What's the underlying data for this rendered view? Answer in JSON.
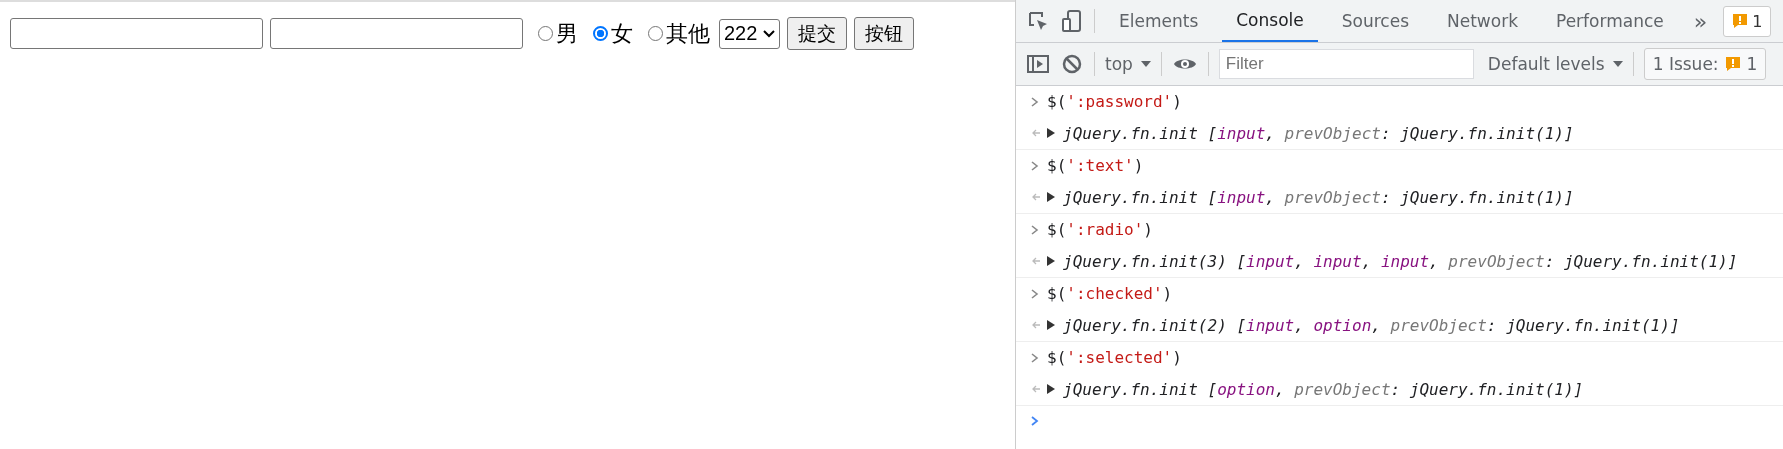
{
  "page": {
    "text_fields": [
      {
        "kind": "input"
      },
      {
        "kind": "input"
      }
    ],
    "radios": [
      {
        "label": "男",
        "selected": false
      },
      {
        "label": "女",
        "selected": true
      },
      {
        "label": "其他",
        "selected": false
      }
    ],
    "select": {
      "value": "222"
    },
    "buttons": [
      "提交",
      "按钮"
    ]
  },
  "devtools": {
    "tabs": [
      {
        "label": "Elements",
        "selected": false
      },
      {
        "label": "Console",
        "selected": true
      },
      {
        "label": "Sources",
        "selected": false
      },
      {
        "label": "Network",
        "selected": false
      },
      {
        "label": "Performance",
        "selected": false
      }
    ],
    "more_tabs": "»",
    "issues_badge": "1",
    "context": "top",
    "filter": {
      "placeholder": "Filter"
    },
    "levels": "Default levels",
    "issues_button": "1 Issue:",
    "issues_count": "1",
    "entries": [
      {
        "command": [
          "$(",
          "':password'",
          ")"
        ],
        "result": [
          {
            "text": "jQuery.fn.init [",
            "kind": "plain"
          },
          {
            "text": "input",
            "kind": "element"
          },
          {
            "text": ", ",
            "kind": "plain"
          },
          {
            "text": "prevObject",
            "kind": "key"
          },
          {
            "text": ": jQuery.fn.init(1)]",
            "kind": "plain"
          }
        ]
      },
      {
        "command": [
          "$(",
          "':text'",
          ")"
        ],
        "result": [
          {
            "text": "jQuery.fn.init [",
            "kind": "plain"
          },
          {
            "text": "input",
            "kind": "element"
          },
          {
            "text": ", ",
            "kind": "plain"
          },
          {
            "text": "prevObject",
            "kind": "key"
          },
          {
            "text": ": jQuery.fn.init(1)]",
            "kind": "plain"
          }
        ]
      },
      {
        "command": [
          "$(",
          "':radio'",
          ")"
        ],
        "result": [
          {
            "text": "jQuery.fn.init(3) [",
            "kind": "plain"
          },
          {
            "text": "input",
            "kind": "element"
          },
          {
            "text": ", ",
            "kind": "plain"
          },
          {
            "text": "input",
            "kind": "element"
          },
          {
            "text": ", ",
            "kind": "plain"
          },
          {
            "text": "input",
            "kind": "element"
          },
          {
            "text": ", ",
            "kind": "plain"
          },
          {
            "text": "prevObject",
            "kind": "key"
          },
          {
            "text": ": jQuery.fn.init(1)]",
            "kind": "plain"
          }
        ]
      },
      {
        "command": [
          "$(",
          "':checked'",
          ")"
        ],
        "result": [
          {
            "text": "jQuery.fn.init(2) [",
            "kind": "plain"
          },
          {
            "text": "input",
            "kind": "element"
          },
          {
            "text": ", ",
            "kind": "plain"
          },
          {
            "text": "option",
            "kind": "element"
          },
          {
            "text": ", ",
            "kind": "plain"
          },
          {
            "text": "prevObject",
            "kind": "key"
          },
          {
            "text": ": jQuery.fn.init(1)]",
            "kind": "plain"
          }
        ]
      },
      {
        "command": [
          "$(",
          "':selected'",
          ")"
        ],
        "result": [
          {
            "text": "jQuery.fn.init [",
            "kind": "plain"
          },
          {
            "text": "option",
            "kind": "element"
          },
          {
            "text": ", ",
            "kind": "plain"
          },
          {
            "text": "prevObject",
            "kind": "key"
          },
          {
            "text": ": jQuery.fn.init(1)]",
            "kind": "plain"
          }
        ]
      }
    ]
  }
}
